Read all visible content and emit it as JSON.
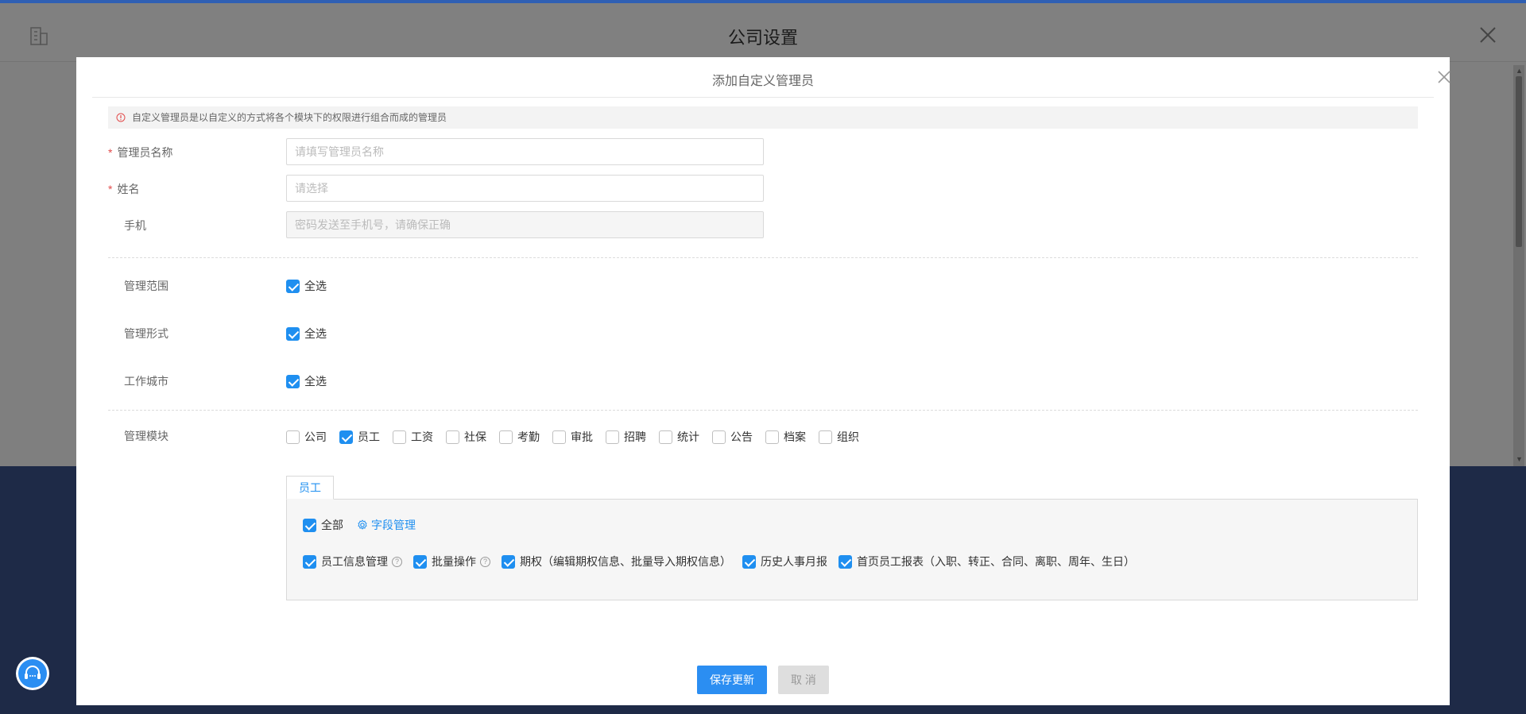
{
  "background": {
    "title": "公司设置"
  },
  "modal": {
    "title": "添加自定义管理员",
    "notice": "自定义管理员是以自定义的方式将各个模块下的权限进行组合而成的管理员"
  },
  "form": {
    "admin_name": {
      "label": "管理员名称",
      "placeholder": "请填写管理员名称",
      "value": ""
    },
    "name": {
      "label": "姓名",
      "placeholder": "请选择",
      "value": ""
    },
    "phone": {
      "label": "手机",
      "placeholder": "密码发送至手机号，请确保正确",
      "value": ""
    },
    "scope": {
      "label": "管理范围",
      "option": "全选",
      "checked": true
    },
    "form_type": {
      "label": "管理形式",
      "option": "全选",
      "checked": true
    },
    "city": {
      "label": "工作城市",
      "option": "全选",
      "checked": true
    },
    "modules_label": "管理模块"
  },
  "modules": [
    {
      "label": "公司",
      "checked": false
    },
    {
      "label": "员工",
      "checked": true
    },
    {
      "label": "工资",
      "checked": false
    },
    {
      "label": "社保",
      "checked": false
    },
    {
      "label": "考勤",
      "checked": false
    },
    {
      "label": "审批",
      "checked": false
    },
    {
      "label": "招聘",
      "checked": false
    },
    {
      "label": "统计",
      "checked": false
    },
    {
      "label": "公告",
      "checked": false
    },
    {
      "label": "档案",
      "checked": false
    },
    {
      "label": "组织",
      "checked": false
    }
  ],
  "tab": {
    "label": "员工"
  },
  "panel": {
    "all_label": "全部",
    "all_checked": true,
    "field_manage": "字段管理",
    "permissions": [
      {
        "label": "员工信息管理",
        "checked": true,
        "help": true
      },
      {
        "label": "批量操作",
        "checked": true,
        "help": true
      },
      {
        "label": "期权（编辑期权信息、批量导入期权信息）",
        "checked": true,
        "help": false
      },
      {
        "label": "历史人事月报",
        "checked": true,
        "help": false
      },
      {
        "label": "首页员工报表（入职、转正、合同、离职、周年、生日）",
        "checked": true,
        "help": false
      }
    ]
  },
  "buttons": {
    "save": "保存更新",
    "cancel": "取 消"
  },
  "colors": {
    "primary": "#2b8ef2",
    "required": "#e24c4c",
    "navy": "#1e2a47"
  }
}
